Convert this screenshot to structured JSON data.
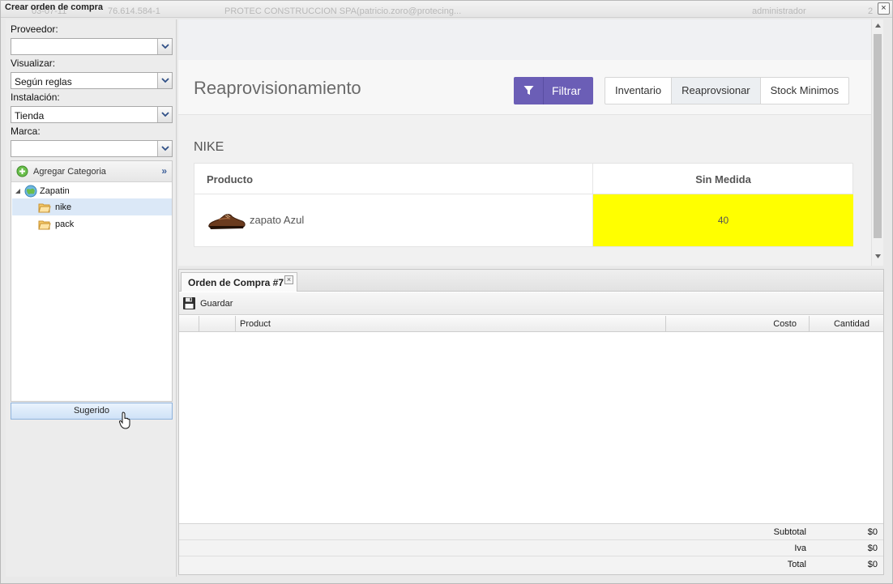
{
  "window": {
    "title": "Crear orden de compra",
    "close_glyph": "×",
    "background_texts": [
      "03-07-11",
      "76.614.584-1",
      "PROTEC CONSTRUCCION SPA(patricio.zoro@protecing...",
      "administrador",
      "2"
    ]
  },
  "filters": {
    "proveedor_label": "Proveedor:",
    "proveedor_value": "",
    "visualizar_label": "Visualizar:",
    "visualizar_value": "Según reglas",
    "instalacion_label": "Instalación:",
    "instalacion_value": "Tienda",
    "marca_label": "Marca:",
    "marca_value": ""
  },
  "tree": {
    "header_label": "Agregar Categoria",
    "expand_glyph": "»",
    "root": "Zapatin",
    "children": [
      "nike",
      "pack"
    ],
    "selected": "nike"
  },
  "suggest_button": "Sugerido",
  "content": {
    "title": "Reaprovisionamiento",
    "filter_button": "Filtrar",
    "tabs": [
      {
        "label": "Inventario",
        "active": false
      },
      {
        "label": "Reaprovsionar",
        "active": true
      },
      {
        "label": "Stock Minimos",
        "active": false
      }
    ],
    "brand": "NIKE",
    "table": {
      "headers": [
        "Producto",
        "Sin Medida"
      ],
      "rows": [
        {
          "product": "zapato Azul",
          "qty": "40"
        }
      ]
    },
    "highlight_color": "#ffff00",
    "accent_color": "#6b5eb6"
  },
  "order": {
    "tab_label": "Orden de Compra #7",
    "tab_close": "×",
    "save_label": "Guardar",
    "columns": [
      "Product",
      "Costo",
      "Cantidad"
    ],
    "totals": [
      {
        "label": "Subtotal",
        "value": "$0"
      },
      {
        "label": "Iva",
        "value": "$0"
      },
      {
        "label": "Total",
        "value": "$0"
      }
    ]
  },
  "icons": {
    "filter": "funnel-icon",
    "add": "plus-circle-icon",
    "save": "floppy-disk-icon",
    "folder": "folder-icon",
    "globe": "globe-icon",
    "shoe": "shoe-image"
  }
}
